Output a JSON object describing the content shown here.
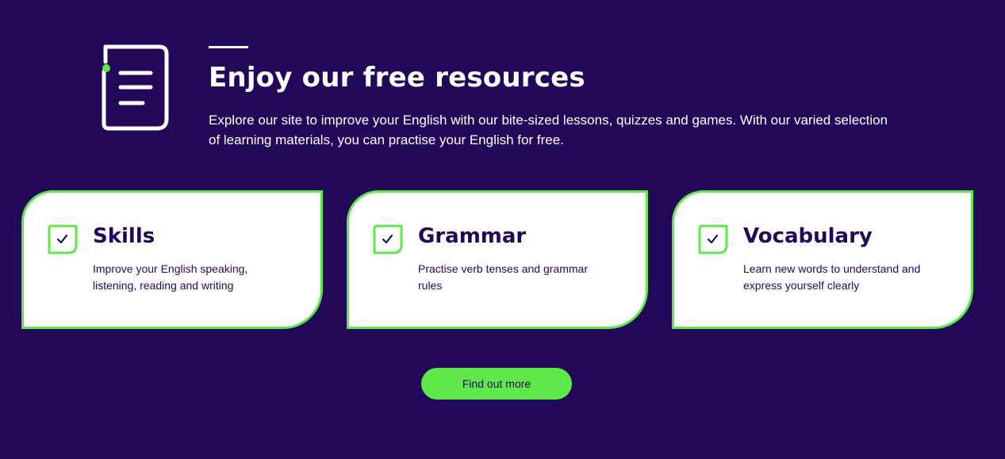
{
  "hero": {
    "icon": "document-list-icon",
    "title": "Enjoy our free resources",
    "intro": "Explore our site to improve your English with our bite-sized lessons, quizzes and games. With our varied selection of learning materials, you can practise your English for free."
  },
  "cards": [
    {
      "icon": "checkmark-icon",
      "title": "Skills",
      "text": "Improve your English speaking, listening, reading and writing"
    },
    {
      "icon": "checkmark-icon",
      "title": "Grammar",
      "text": "Practise verb tenses and grammar rules"
    },
    {
      "icon": "checkmark-icon",
      "title": "Vocabulary",
      "text": "Learn new words to understand and express yourself clearly"
    }
  ],
  "cta": {
    "label": "Find out more"
  },
  "colors": {
    "background": "#23085a",
    "accent": "#5ee84a",
    "card_background": "#ffffff",
    "text_light": "#ffffff",
    "text_dark": "#23085a"
  }
}
